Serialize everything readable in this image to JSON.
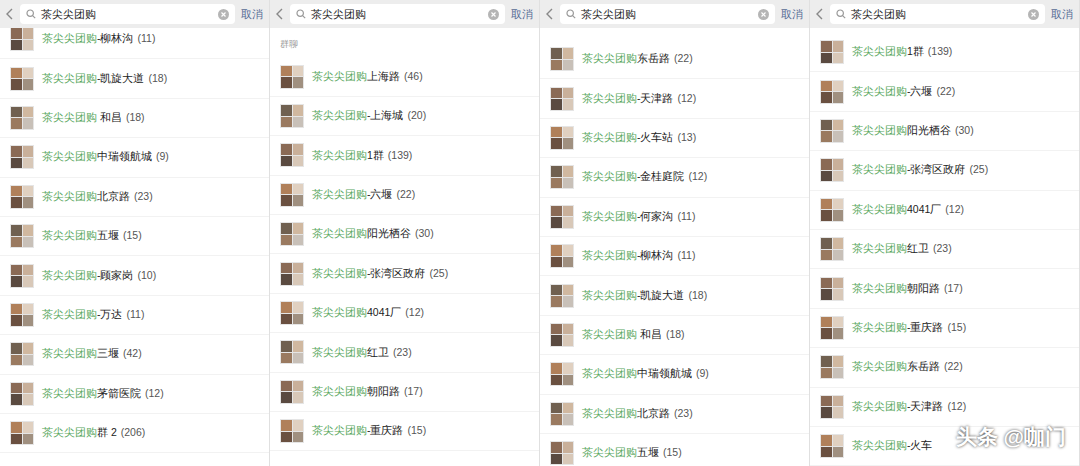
{
  "panels": [
    {
      "search": {
        "query": "茶尖尖团购",
        "cancel": "取消"
      },
      "section": "",
      "rows": [
        {
          "name": "茶尖尖团购-柳林沟",
          "count": "(11)"
        },
        {
          "name": "茶尖尖团购-凯旋大道",
          "count": "(18)"
        },
        {
          "name": "茶尖尖团购 和昌",
          "count": "(18)"
        },
        {
          "name": "茶尖尖团购中瑞领航城",
          "count": "(9)"
        },
        {
          "name": "茶尖尖团购北京路",
          "count": "(23)"
        },
        {
          "name": "茶尖尖团购五堰",
          "count": "(15)"
        },
        {
          "name": "茶尖尖团购-顾家岗",
          "count": "(10)"
        },
        {
          "name": "茶尖尖团购-万达",
          "count": "(11)"
        },
        {
          "name": "茶尖尖团购三堰",
          "count": "(42)"
        },
        {
          "name": "茶尖尖团购茅箭医院",
          "count": "(12)"
        },
        {
          "name": "茶尖尖团购群 2",
          "count": "(206)"
        }
      ]
    },
    {
      "search": {
        "query": "茶尖尖团购",
        "cancel": "取消"
      },
      "section": "群聊",
      "rows": [
        {
          "name": "茶尖尖团购上海路",
          "count": "(46)"
        },
        {
          "name": "茶尖尖团购-上海城",
          "count": "(20)"
        },
        {
          "name": "茶尖尖团购1群",
          "count": "(139)"
        },
        {
          "name": "茶尖尖团购-六堰",
          "count": "(22)"
        },
        {
          "name": "茶尖尖团购阳光栖谷",
          "count": "(30)"
        },
        {
          "name": "茶尖尖团购-张湾区政府",
          "count": "(25)"
        },
        {
          "name": "茶尖尖团购4041厂",
          "count": "(12)"
        },
        {
          "name": "茶尖尖团购红卫",
          "count": "(23)"
        },
        {
          "name": "茶尖尖团购朝阳路",
          "count": "(17)"
        },
        {
          "name": "茶尖尖团购-重庆路",
          "count": "(15)"
        }
      ]
    },
    {
      "search": {
        "query": "茶尖尖团购",
        "cancel": "取消"
      },
      "section": "",
      "rows": [
        {
          "name": "茶尖尖团购东岳路",
          "count": "(22)"
        },
        {
          "name": "茶尖尖团购-天津路",
          "count": "(12)"
        },
        {
          "name": "茶尖尖团购-火车站",
          "count": "(13)"
        },
        {
          "name": "茶尖尖团购-金桂庭院",
          "count": "(12)"
        },
        {
          "name": "茶尖尖团购-何家沟",
          "count": "(11)"
        },
        {
          "name": "茶尖尖团购-柳林沟",
          "count": "(11)"
        },
        {
          "name": "茶尖尖团购-凯旋大道",
          "count": "(18)"
        },
        {
          "name": "茶尖尖团购 和昌",
          "count": "(18)"
        },
        {
          "name": "茶尖尖团购中瑞领航城",
          "count": "(9)"
        },
        {
          "name": "茶尖尖团购北京路",
          "count": "(23)"
        },
        {
          "name": "茶尖尖团购五堰",
          "count": "(15)"
        }
      ]
    },
    {
      "search": {
        "query": "茶尖尖团购",
        "cancel": "取消"
      },
      "section": "",
      "rows": [
        {
          "name": "茶尖尖团购1群",
          "count": "(139)"
        },
        {
          "name": "茶尖尖团购-六堰",
          "count": "(22)"
        },
        {
          "name": "茶尖尖团购阳光栖谷",
          "count": "(30)"
        },
        {
          "name": "茶尖尖团购-张湾区政府",
          "count": "(25)"
        },
        {
          "name": "茶尖尖团购4041厂",
          "count": "(12)"
        },
        {
          "name": "茶尖尖团购红卫",
          "count": "(23)"
        },
        {
          "name": "茶尖尖团购朝阳路",
          "count": "(17)"
        },
        {
          "name": "茶尖尖团购-重庆路",
          "count": "(15)"
        },
        {
          "name": "茶尖尖团购东岳路",
          "count": "(22)"
        },
        {
          "name": "茶尖尖团购-天津路",
          "count": "(12)"
        },
        {
          "name": "茶尖尖团购-火车",
          "count": ""
        }
      ]
    }
  ],
  "watermark": "头条 @咖门"
}
